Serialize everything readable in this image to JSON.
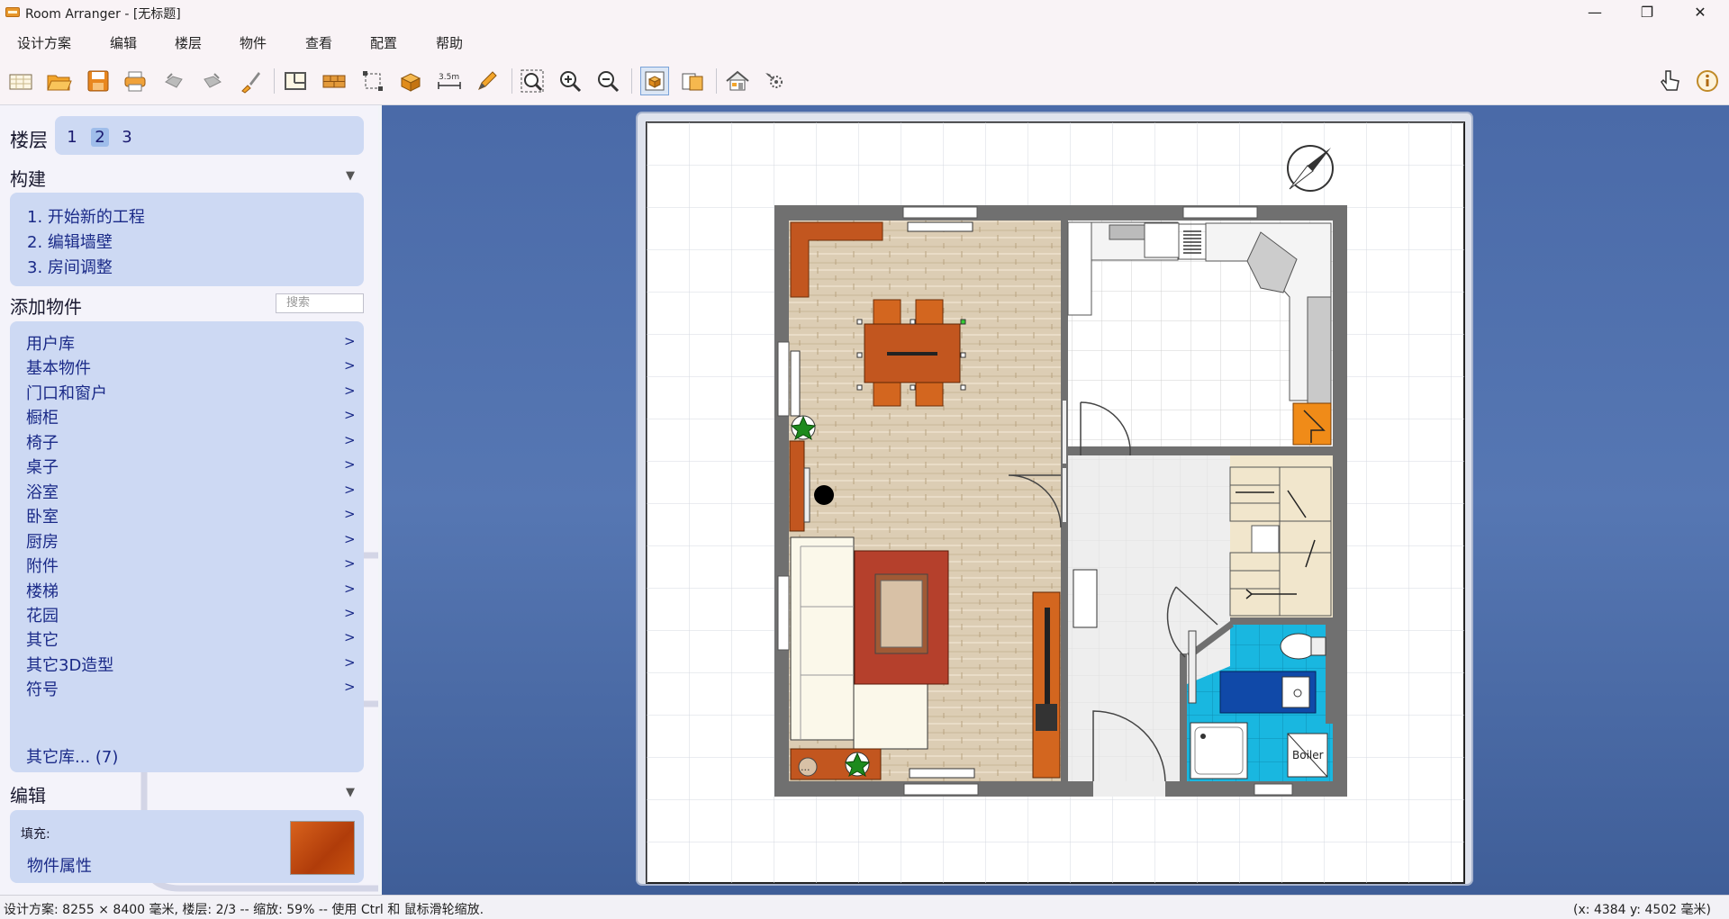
{
  "window": {
    "title": "Room Arranger - [无标题]",
    "minimize": "—",
    "restore": "❐",
    "close": "✕"
  },
  "menu": [
    "设计方案",
    "编辑",
    "楼层",
    "物件",
    "查看",
    "配置",
    "帮助"
  ],
  "toolbar": {
    "icons": [
      "new-document-icon",
      "open-folder-icon",
      "save-icon",
      "print-icon",
      "undo-icon",
      "redo-icon",
      "brush-icon",
      "floor-plan-icon",
      "wall-icon",
      "room-resize-icon",
      "add-object-icon",
      "measure-icon",
      "pencil-icon",
      "zoom-fit-icon",
      "zoom-in-icon",
      "zoom-out-icon",
      "view-2d-icon",
      "objects-list-icon",
      "3d-house-icon",
      "3d-render-icon",
      "hand-pointer-icon",
      "info-icon"
    ],
    "measure_label": "3.5m"
  },
  "sidebar": {
    "floors": {
      "label": "楼层",
      "items": [
        "1",
        "2",
        "3"
      ],
      "selected": "2"
    },
    "build": {
      "title": "构建",
      "items": [
        "1. 开始新的工程",
        "2. 编辑墙壁",
        "3. 房间调整"
      ]
    },
    "add_objects": {
      "title": "添加物件",
      "search_placeholder": "搜索",
      "items": [
        "用户库",
        "基本物件",
        "门口和窗户",
        "橱柜",
        "椅子",
        "桌子",
        "浴室",
        "卧室",
        "厨房",
        "附件",
        "楼梯",
        "花园",
        "其它",
        "其它3D造型",
        "符号"
      ],
      "chevron": ">",
      "other_libs": "其它库... (7)"
    },
    "edit": {
      "title": "编辑",
      "fill_label": "填充:",
      "props_label": "物件属性",
      "fill_color": "#c2480f"
    }
  },
  "plan": {
    "boiler_label": "Boiler",
    "more_label": "..."
  },
  "status": {
    "left": "设计方案: 8255 × 8400 毫米, 楼层: 2/3 -- 缩放: 59% -- 使用 Ctrl 和 鼠标滑轮缩放.",
    "right": "(x: 4384 y: 4502 毫米)"
  },
  "colors": {
    "canvas_bg": "#4a6aa8",
    "wall": "#6f6f6f",
    "wood_floor": "#dccdb4",
    "tiles_blue": "#19b7e0",
    "furniture_wood": "#c2561f",
    "sofa": "#fbf8ea",
    "carpet_red": "#b5402c",
    "panel_blue": "#cdd9f3"
  }
}
